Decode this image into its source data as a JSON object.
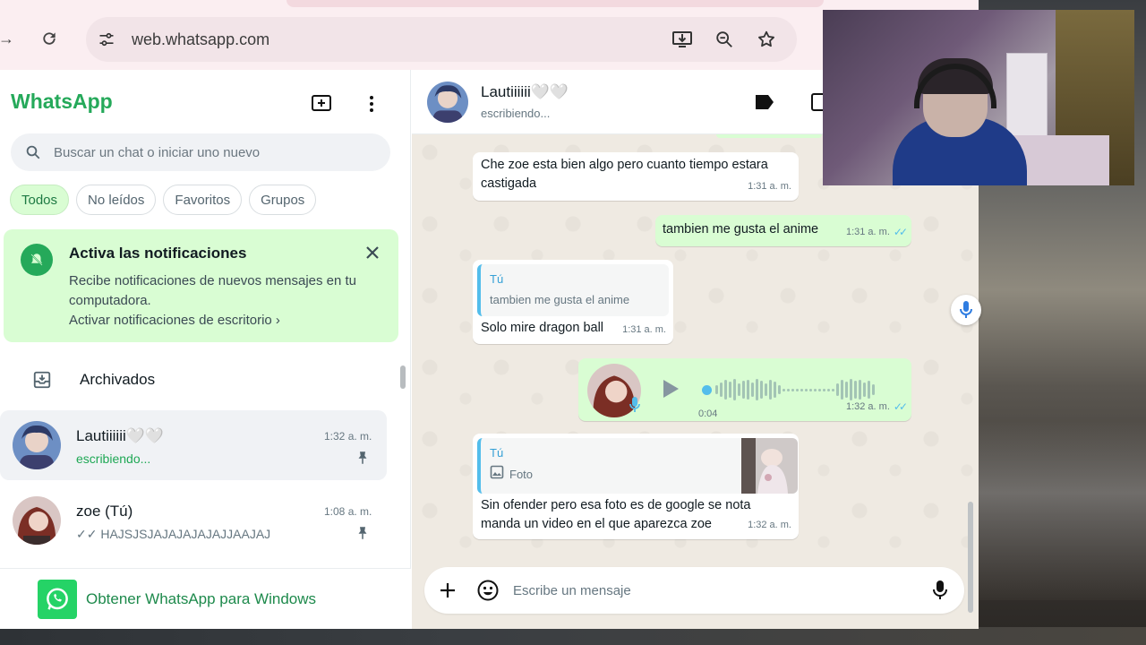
{
  "browser": {
    "url": "web.whatsapp.com"
  },
  "sidebar": {
    "brand": "WhatsApp",
    "search_placeholder": "Buscar un chat o iniciar uno nuevo",
    "filters": [
      "Todos",
      "No leídos",
      "Favoritos",
      "Grupos"
    ],
    "notification": {
      "title": "Activa las notificaciones",
      "body": "Recibe notificaciones de nuevos mensajes en tu computadora.",
      "link": "Activar notificaciones de escritorio ›"
    },
    "archived_label": "Archivados",
    "chats": [
      {
        "name": "Lautiiiiii🤍🤍",
        "time": "1:32 a. m.",
        "preview": "escribiendo..."
      },
      {
        "name": "zoe (Tú)",
        "time": "1:08 a. m.",
        "preview": "✓✓ HAJSJSJAJAJAJAJAJJAAJAJ"
      }
    ],
    "get_app_label": "Obtener WhatsApp para Windows"
  },
  "conversation": {
    "contact_name": "Lautiiiiii🤍🤍",
    "status": "escribiendo...",
    "messages": [
      {
        "dir": "in",
        "text": "Che zoe esta bien algo pero cuanto tiempo estara castigada",
        "time": "1:31 a. m."
      },
      {
        "dir": "out",
        "text": "tambien me gusta el anime",
        "time": "1:31 a. m."
      },
      {
        "dir": "in",
        "quote_who": "Tú",
        "quote_text": "tambien me gusta el anime",
        "text": "Solo mire dragon ball",
        "time": "1:31 a. m."
      },
      {
        "dir": "out",
        "type": "voice",
        "duration": "0:04",
        "time": "1:32 a. m."
      },
      {
        "dir": "in",
        "quote_who": "Tú",
        "quote_text": "Foto",
        "text": "Sin ofender pero esa foto es de google se nota manda un video en el que aparezca zoe",
        "time": "1:32 a. m."
      }
    ],
    "composer_placeholder": "Escribe un mensaje"
  },
  "colors": {
    "brand_green": "#25a95a",
    "out_bubble": "#d9fdd3",
    "in_bubble": "#ffffff",
    "chat_bg": "#efeae2",
    "read_ticks": "#53bdeb"
  }
}
